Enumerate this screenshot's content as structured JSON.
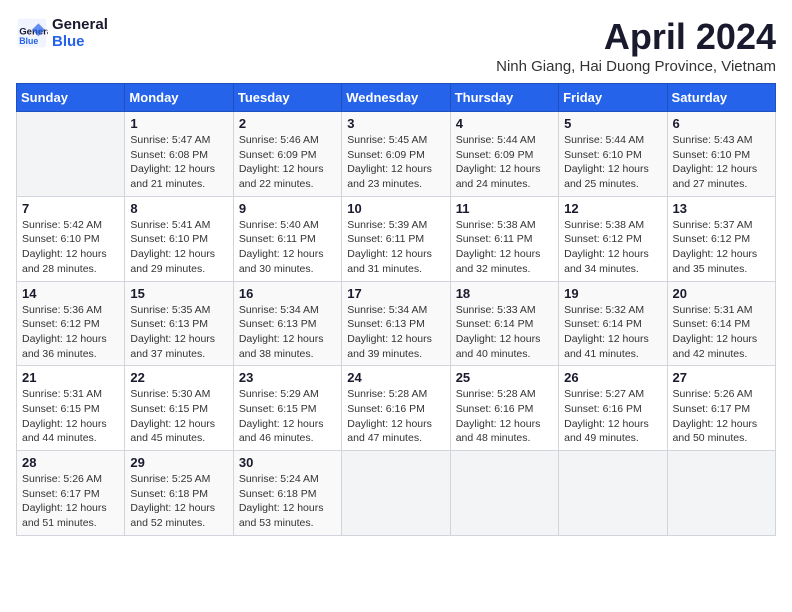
{
  "header": {
    "logo_line1": "General",
    "logo_line2": "Blue",
    "month_title": "April 2024",
    "subtitle": "Ninh Giang, Hai Duong Province, Vietnam"
  },
  "weekdays": [
    "Sunday",
    "Monday",
    "Tuesday",
    "Wednesday",
    "Thursday",
    "Friday",
    "Saturday"
  ],
  "weeks": [
    [
      {
        "num": "",
        "detail": ""
      },
      {
        "num": "1",
        "detail": "Sunrise: 5:47 AM\nSunset: 6:08 PM\nDaylight: 12 hours\nand 21 minutes."
      },
      {
        "num": "2",
        "detail": "Sunrise: 5:46 AM\nSunset: 6:09 PM\nDaylight: 12 hours\nand 22 minutes."
      },
      {
        "num": "3",
        "detail": "Sunrise: 5:45 AM\nSunset: 6:09 PM\nDaylight: 12 hours\nand 23 minutes."
      },
      {
        "num": "4",
        "detail": "Sunrise: 5:44 AM\nSunset: 6:09 PM\nDaylight: 12 hours\nand 24 minutes."
      },
      {
        "num": "5",
        "detail": "Sunrise: 5:44 AM\nSunset: 6:10 PM\nDaylight: 12 hours\nand 25 minutes."
      },
      {
        "num": "6",
        "detail": "Sunrise: 5:43 AM\nSunset: 6:10 PM\nDaylight: 12 hours\nand 27 minutes."
      }
    ],
    [
      {
        "num": "7",
        "detail": "Sunrise: 5:42 AM\nSunset: 6:10 PM\nDaylight: 12 hours\nand 28 minutes."
      },
      {
        "num": "8",
        "detail": "Sunrise: 5:41 AM\nSunset: 6:10 PM\nDaylight: 12 hours\nand 29 minutes."
      },
      {
        "num": "9",
        "detail": "Sunrise: 5:40 AM\nSunset: 6:11 PM\nDaylight: 12 hours\nand 30 minutes."
      },
      {
        "num": "10",
        "detail": "Sunrise: 5:39 AM\nSunset: 6:11 PM\nDaylight: 12 hours\nand 31 minutes."
      },
      {
        "num": "11",
        "detail": "Sunrise: 5:38 AM\nSunset: 6:11 PM\nDaylight: 12 hours\nand 32 minutes."
      },
      {
        "num": "12",
        "detail": "Sunrise: 5:38 AM\nSunset: 6:12 PM\nDaylight: 12 hours\nand 34 minutes."
      },
      {
        "num": "13",
        "detail": "Sunrise: 5:37 AM\nSunset: 6:12 PM\nDaylight: 12 hours\nand 35 minutes."
      }
    ],
    [
      {
        "num": "14",
        "detail": "Sunrise: 5:36 AM\nSunset: 6:12 PM\nDaylight: 12 hours\nand 36 minutes."
      },
      {
        "num": "15",
        "detail": "Sunrise: 5:35 AM\nSunset: 6:13 PM\nDaylight: 12 hours\nand 37 minutes."
      },
      {
        "num": "16",
        "detail": "Sunrise: 5:34 AM\nSunset: 6:13 PM\nDaylight: 12 hours\nand 38 minutes."
      },
      {
        "num": "17",
        "detail": "Sunrise: 5:34 AM\nSunset: 6:13 PM\nDaylight: 12 hours\nand 39 minutes."
      },
      {
        "num": "18",
        "detail": "Sunrise: 5:33 AM\nSunset: 6:14 PM\nDaylight: 12 hours\nand 40 minutes."
      },
      {
        "num": "19",
        "detail": "Sunrise: 5:32 AM\nSunset: 6:14 PM\nDaylight: 12 hours\nand 41 minutes."
      },
      {
        "num": "20",
        "detail": "Sunrise: 5:31 AM\nSunset: 6:14 PM\nDaylight: 12 hours\nand 42 minutes."
      }
    ],
    [
      {
        "num": "21",
        "detail": "Sunrise: 5:31 AM\nSunset: 6:15 PM\nDaylight: 12 hours\nand 44 minutes."
      },
      {
        "num": "22",
        "detail": "Sunrise: 5:30 AM\nSunset: 6:15 PM\nDaylight: 12 hours\nand 45 minutes."
      },
      {
        "num": "23",
        "detail": "Sunrise: 5:29 AM\nSunset: 6:15 PM\nDaylight: 12 hours\nand 46 minutes."
      },
      {
        "num": "24",
        "detail": "Sunrise: 5:28 AM\nSunset: 6:16 PM\nDaylight: 12 hours\nand 47 minutes."
      },
      {
        "num": "25",
        "detail": "Sunrise: 5:28 AM\nSunset: 6:16 PM\nDaylight: 12 hours\nand 48 minutes."
      },
      {
        "num": "26",
        "detail": "Sunrise: 5:27 AM\nSunset: 6:16 PM\nDaylight: 12 hours\nand 49 minutes."
      },
      {
        "num": "27",
        "detail": "Sunrise: 5:26 AM\nSunset: 6:17 PM\nDaylight: 12 hours\nand 50 minutes."
      }
    ],
    [
      {
        "num": "28",
        "detail": "Sunrise: 5:26 AM\nSunset: 6:17 PM\nDaylight: 12 hours\nand 51 minutes."
      },
      {
        "num": "29",
        "detail": "Sunrise: 5:25 AM\nSunset: 6:18 PM\nDaylight: 12 hours\nand 52 minutes."
      },
      {
        "num": "30",
        "detail": "Sunrise: 5:24 AM\nSunset: 6:18 PM\nDaylight: 12 hours\nand 53 minutes."
      },
      {
        "num": "",
        "detail": ""
      },
      {
        "num": "",
        "detail": ""
      },
      {
        "num": "",
        "detail": ""
      },
      {
        "num": "",
        "detail": ""
      }
    ]
  ]
}
